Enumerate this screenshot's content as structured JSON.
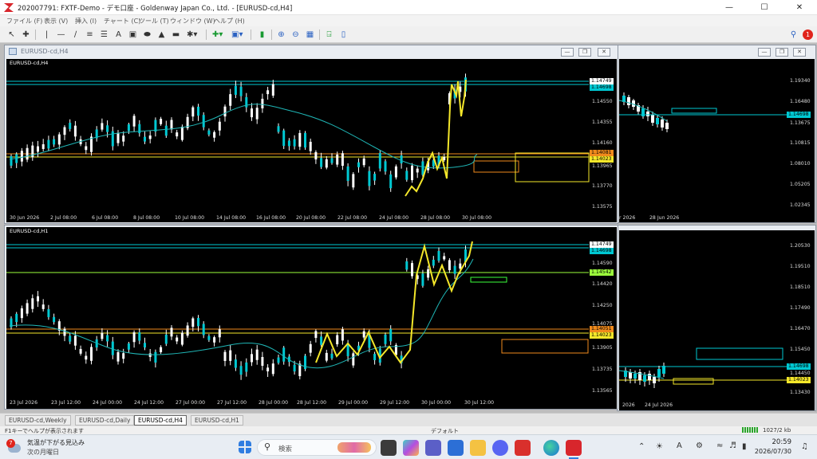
{
  "app": {
    "title": "202007791: FXTF-Demo - デモ口座 - Goldenway Japan Co., Ltd. - [EURUSD-cd,H4]",
    "menu": [
      "ファイル (F)",
      "表示 (V)",
      "挿入 (I)",
      "チャート (C)",
      "ツール (T)",
      "ウィンドウ (W)",
      "ヘルプ (H)"
    ],
    "notification_count": "1",
    "colors": {
      "chart_bg": "#000000",
      "candle_up": "#00c8d2",
      "candle_down": "#ffffff",
      "zigzag": "#f4e72a",
      "ma": "#1fb6b6",
      "orange": "#f08a1c",
      "green": "#3cff3c"
    }
  },
  "windows": {
    "h4": {
      "title": "EURUSD-cd,H4",
      "symbol": "EURUSD-cd,H4",
      "price_labels": [
        "1.14749",
        "1.14698",
        "1.14550",
        "1.14355",
        "1.14160",
        "1.14081",
        "1.14023",
        "1.13965",
        "1.13770",
        "1.13575"
      ],
      "time_labels": [
        "30 Jun 2026",
        "2 Jul 08:00",
        "6 Jul 08:00",
        "8 Jul 08:00",
        "10 Jul 08:00",
        "14 Jul 08:00",
        "16 Jul 08:00",
        "20 Jul 08:00",
        "22 Jul 08:00",
        "24 Jul 08:00",
        "28 Jul 08:00",
        "30 Jul 08:00"
      ]
    },
    "daily_bg": {
      "price_labels": [
        "1.19340",
        "1.16480",
        "1.14698",
        "1.13675",
        "1.10815",
        "1.08010",
        "1.05205",
        "1.02345"
      ],
      "time_labels": [
        "r 2026",
        "28 Jun 2026"
      ]
    },
    "h1": {
      "symbol": "EURUSD-cd,H1",
      "price_labels": [
        "1.14749",
        "1.14698",
        "1.14590",
        "1.14542",
        "1.14420",
        "1.14250",
        "1.14075",
        "1.14051",
        "1.14023",
        "1.13905",
        "1.13735",
        "1.13565"
      ],
      "time_labels": [
        "23 Jul 2026",
        "23 Jul 12:00",
        "24 Jul 00:00",
        "24 Jul 12:00",
        "27 Jul 00:00",
        "27 Jul 12:00",
        "28 Jul 00:00",
        "28 Jul 12:00",
        "29 Jul 00:00",
        "29 Jul 12:00",
        "30 Jul 00:00",
        "30 Jul 12:00"
      ]
    },
    "weekly_bg": {
      "price_labels": [
        "1.20530",
        "1.19510",
        "1.18510",
        "1.17490",
        "1.16470",
        "1.15450",
        "1.14698",
        "1.14450",
        "1.14023",
        "1.13430"
      ],
      "time_labels": [
        "2026",
        "24 Jul 2026"
      ]
    }
  },
  "tabs": [
    "EURUSD-cd,Weekly",
    "EURUSD-cd,Daily",
    "EURUSD-cd,H4",
    "EURUSD-cd,H1"
  ],
  "active_tab": "EURUSD-cd,H4",
  "status": {
    "help": "F1キーでヘルプが表示されます",
    "profile": "デフォルト",
    "traffic": "1027/2 kb"
  },
  "taskbar": {
    "weather_badge": "7",
    "weather_line1": "気温が下がる見込み",
    "weather_line2": "次の月曜日",
    "search_placeholder": "検索",
    "time": "20:59",
    "date": "2026/07/30",
    "ime": "A"
  }
}
